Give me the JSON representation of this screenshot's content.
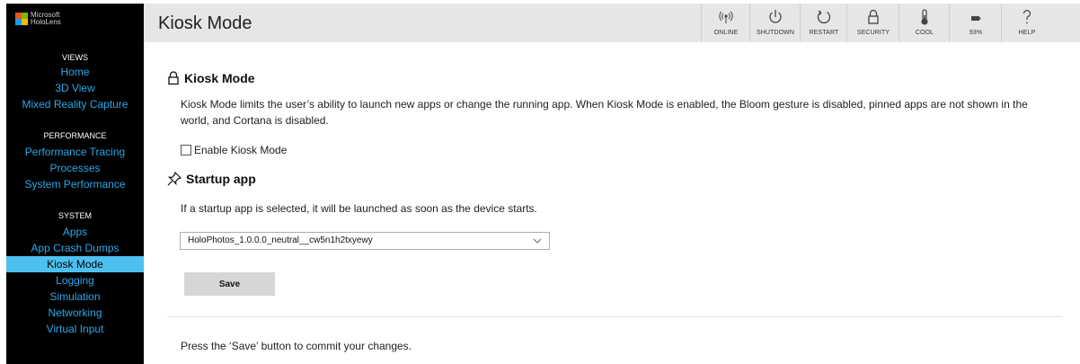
{
  "brand": {
    "line1": "Microsoft",
    "line2": "HoloLens"
  },
  "sidebar": {
    "sections": [
      {
        "heading": "VIEWS",
        "items": [
          {
            "label": "Home"
          },
          {
            "label": "3D View"
          },
          {
            "label": "Mixed Reality Capture"
          }
        ]
      },
      {
        "heading": "PERFORMANCE",
        "items": [
          {
            "label": "Performance Tracing"
          },
          {
            "label": "Processes"
          },
          {
            "label": "System Performance"
          }
        ]
      },
      {
        "heading": "SYSTEM",
        "items": [
          {
            "label": "Apps"
          },
          {
            "label": "App Crash Dumps"
          },
          {
            "label": "Kiosk Mode",
            "active": true
          },
          {
            "label": "Logging"
          },
          {
            "label": "Simulation"
          },
          {
            "label": "Networking"
          },
          {
            "label": "Virtual Input"
          }
        ]
      }
    ]
  },
  "header": {
    "title": "Kiosk Mode",
    "buttons": [
      {
        "label": "ONLINE",
        "icon": "wifi-icon"
      },
      {
        "label": "SHUTDOWN",
        "icon": "power-icon"
      },
      {
        "label": "RESTART",
        "icon": "restart-icon"
      },
      {
        "label": "SECURITY",
        "icon": "lock-icon"
      },
      {
        "label": "COOL",
        "icon": "thermometer-icon"
      },
      {
        "label": "93%",
        "icon": "battery-icon"
      },
      {
        "label": "HELP",
        "icon": "help-icon"
      }
    ]
  },
  "kiosk": {
    "heading": "Kiosk Mode",
    "description_line1": "Kiosk Mode limits the user’s ability to launch new apps or change the running app. When Kiosk Mode is enabled, the Bloom gesture is disabled, pinned apps are not shown in the",
    "description_line2": "world, and Cortana is disabled.",
    "enable_label": "Enable Kiosk Mode",
    "enabled": false
  },
  "startup": {
    "heading": "Startup app",
    "description": "If a startup app is selected, it will be launched as soon as the device starts.",
    "selected_app": "HoloPhotos_1.0.0.0_neutral__cw5n1h2txyewy"
  },
  "actions": {
    "save_label": "Save",
    "footer_note": "Press the ‘Save’ button to commit your changes."
  },
  "colors": {
    "sidebar_bg": "#000000",
    "link": "#2aa7e8",
    "active_bg": "#4ec0ef",
    "topbar_bg": "#e6e6e6",
    "save_bg": "#d6d6d6"
  }
}
